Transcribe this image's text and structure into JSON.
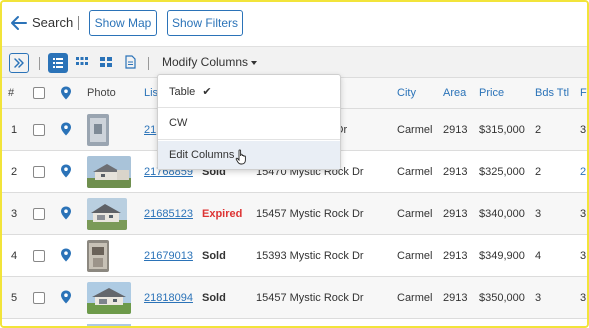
{
  "header": {
    "back_label": "Search",
    "show_map_label": "Show Map",
    "show_filters_label": "Show Filters"
  },
  "toolbar": {
    "modify_columns_label": "Modify Columns",
    "icons": [
      "expand-panel-icon",
      "list-view-icon",
      "grid-view-icon",
      "tile-view-icon",
      "document-icon"
    ]
  },
  "columns": {
    "num": "#",
    "photo": "Photo",
    "mls": "Lis",
    "city": "City",
    "area": "Area",
    "price": "Price",
    "beds": "Bds Ttl",
    "baths": "FB"
  },
  "dropdown": {
    "items": [
      "Table",
      "CW",
      "Edit Columns"
    ],
    "checked_item": "Table",
    "check_glyph": "✔"
  },
  "rows": [
    {
      "num": "1",
      "mls": "21",
      "status": "",
      "address": "k Dr",
      "city": "Carmel",
      "area": "2913",
      "price": "$315,000",
      "beds": "2",
      "baths": "3"
    },
    {
      "num": "2",
      "mls": "21768859",
      "status": "Sold",
      "address": "15470 Mystic Rock Dr",
      "city": "Carmel",
      "area": "2913",
      "price": "$325,000",
      "beds": "2",
      "baths": "2"
    },
    {
      "num": "3",
      "mls": "21685123",
      "status": "Expired",
      "address": "15457 Mystic Rock Dr",
      "city": "Carmel",
      "area": "2913",
      "price": "$340,000",
      "beds": "3",
      "baths": "3"
    },
    {
      "num": "4",
      "mls": "21679013",
      "status": "Sold",
      "address": "15393 Mystic Rock Dr",
      "city": "Carmel",
      "area": "2913",
      "price": "$349,900",
      "beds": "4",
      "baths": "3"
    },
    {
      "num": "5",
      "mls": "21818094",
      "status": "Sold",
      "address": "15457 Mystic Rock Dr",
      "city": "Carmel",
      "area": "2913",
      "price": "$350,000",
      "beds": "3",
      "baths": "3"
    }
  ],
  "colors": {
    "accent": "#2b73b8",
    "expired": "#d33333",
    "frame": "#f2e43a"
  }
}
